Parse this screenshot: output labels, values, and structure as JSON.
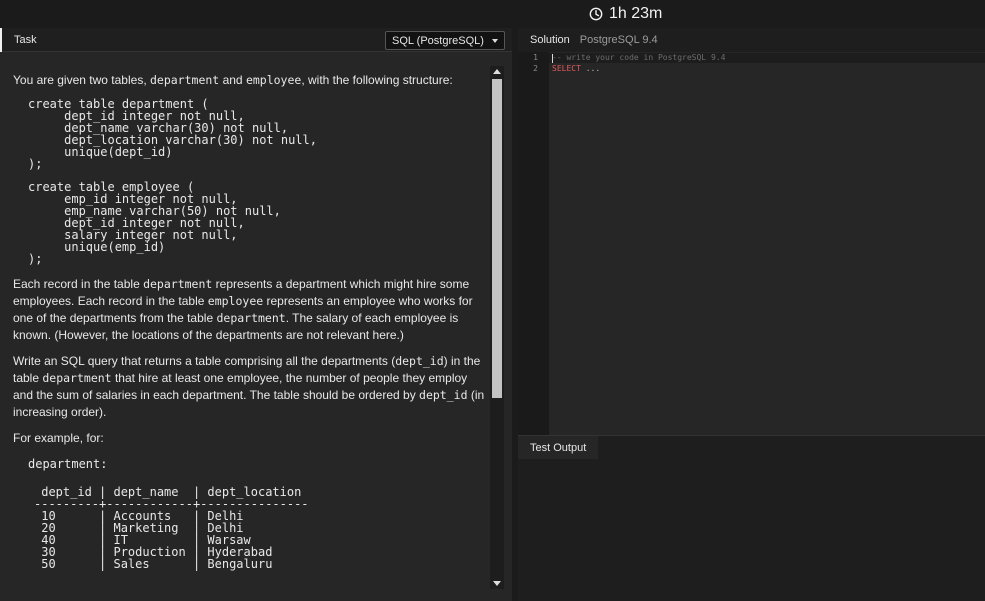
{
  "timer": {
    "text": "1h 23m"
  },
  "task_panel": {
    "tab_label": "Task",
    "language_select": "SQL (PostgreSQL)",
    "intro": [
      "You are given two tables, ",
      "department",
      " and ",
      "employee",
      ", with the following structure:"
    ],
    "schema_department": "create table department (\n     dept_id integer not null,\n     dept_name varchar(30) not null,\n     dept_location varchar(30) not null,\n     unique(dept_id)\n);",
    "schema_employee": "create table employee (\n     emp_id integer not null,\n     emp_name varchar(50) not null,\n     dept_id integer not null,\n     salary integer not null,\n     unique(emp_id)\n);",
    "para1": [
      "Each record in the table ",
      "department",
      " represents a department which might hire some employees. Each record in the table ",
      "employee",
      " represents an employee who works for one of the departments from the table ",
      "department",
      ". The salary of each employee is known. (However, the locations of the departments are not relevant here.)"
    ],
    "para2": [
      "Write an SQL query that returns a table comprising all the departments (",
      "dept_id",
      ") in the table ",
      "department",
      " that hire at least one employee, the number of people they employ and the sum of salaries in each department. The table should be ordered by ",
      "dept_id",
      " (in increasing order)."
    ],
    "example_intro": "For example, for:",
    "example_table_label": "department:",
    "example_table": " dept_id | dept_name  | dept_location\n---------+------------+---------------\n 10      | Accounts   | Delhi\n 20      | Marketing  | Delhi\n 40      | IT         | Warsaw\n 30      | Production | Hyderabad\n 50      | Sales      | Bengaluru"
  },
  "solution_panel": {
    "tab_label": "Solution",
    "language": "PostgreSQL 9.4",
    "editor": {
      "line_numbers": [
        "1",
        "2"
      ],
      "line1": "-- write your code in PostgreSQL 9.4",
      "line2_keyword": "SELECT",
      "line2_rest": " ..."
    }
  },
  "test_output": {
    "tab_label": "Test Output"
  },
  "colors": {
    "background": "#1b1b1b",
    "panel": "#262626",
    "keyword": "#e05a5a",
    "comment": "#6d6d6d"
  }
}
